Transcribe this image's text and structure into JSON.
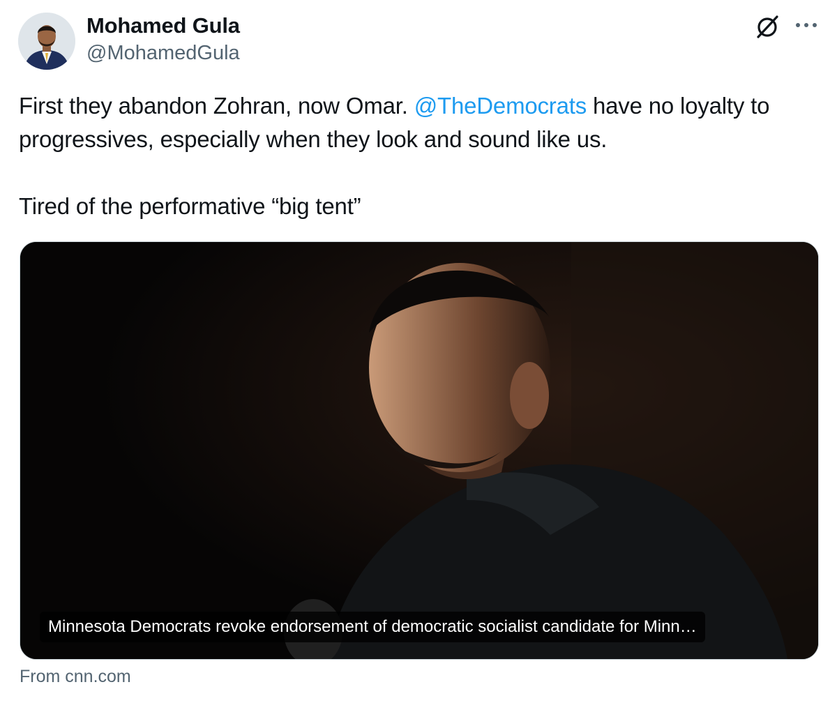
{
  "author": {
    "display_name": "Mohamed Gula",
    "handle": "@MohamedGula",
    "avatar_icon": "profile-photo"
  },
  "header_icons": {
    "grok": "grok-icon",
    "more": "more-dots-icon"
  },
  "tweet": {
    "line1_before_mention": "First they abandon Zohran, now Omar. ",
    "mention": "@TheDemocrats",
    "line1_after_mention": " have no loyalty to progressives, especially when they look and sound like us.",
    "paragraph2": "Tired of the performative “big tent”"
  },
  "link_card": {
    "title": "Minnesota Democrats revoke endorsement of democratic socialist candidate for Minn…",
    "source": "From cnn.com"
  },
  "colors": {
    "link": "#1d9bf0",
    "secondary_text": "#536471",
    "primary_text": "#0f1419",
    "border": "#cfd9de"
  }
}
